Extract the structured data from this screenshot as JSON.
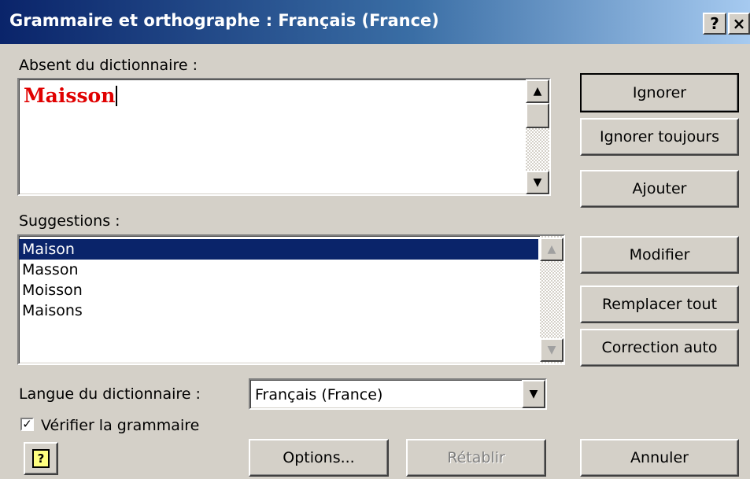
{
  "window": {
    "title": "Grammaire et orthographe : Français (France)",
    "help_glyph": "?",
    "close_glyph": "×"
  },
  "not_in_dictionary": {
    "label": "Absent du dictionnaire :",
    "word": "Maisson"
  },
  "suggestions": {
    "label": "Suggestions :",
    "items": [
      "Maison",
      "Masson",
      "Moisson",
      "Maisons"
    ],
    "selected_index": 0
  },
  "buttons": {
    "ignore": "Ignorer",
    "ignore_all": "Ignorer toujours",
    "add": "Ajouter",
    "change": "Modifier",
    "change_all": "Remplacer tout",
    "autocorrect": "Correction auto",
    "options": "Options...",
    "undo": "Rétablir",
    "cancel": "Annuler"
  },
  "language": {
    "label": "Langue du dictionnaire :",
    "value": "Français (France)"
  },
  "grammar_check": {
    "label": "Vérifier la grammaire",
    "checked": true
  },
  "colors": {
    "misspelled_word": "#e00000",
    "selection": "#0a246a",
    "title_gradient_start": "#0a246a",
    "face": "#d4d0c8"
  }
}
